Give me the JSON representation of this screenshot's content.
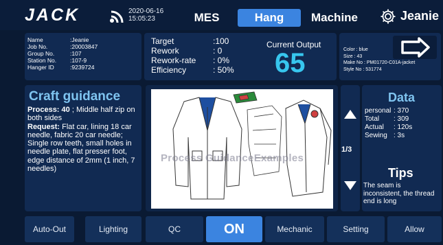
{
  "header": {
    "logo": "JACK",
    "date": "2020-06-16",
    "time": "15:05:23",
    "tabs": [
      "MES",
      "Hang",
      "Machine"
    ],
    "active_tab": "Hang",
    "user": "Jeanie",
    "colors": {
      "active": "#3b84e0",
      "accent": "#37c6ee"
    },
    "icons": [
      "wifi-icon",
      "gear-icon",
      "logout-arrow-icon"
    ]
  },
  "worker_info": {
    "name_label": "Name",
    "name": ":Jeanie",
    "job_label": "Job No.",
    "job": ":20003847",
    "group_label": "Group No.",
    "group": ":107",
    "station_label": "Station No.",
    "station": ":107-9",
    "hanger_label": "Hanger ID",
    "hanger": ":9239724"
  },
  "stats": {
    "target_label": "Target",
    "target": ":100",
    "rework_label": "Rework",
    "rework": ": 0",
    "rework_rate_label": "Rework-rate",
    "rework_rate": ": 0%",
    "efficiency_label": "Efficiency",
    "efficiency": ": 50%",
    "current_output_label": "Current Output",
    "current_output": "65"
  },
  "style": {
    "color": "Color : blue",
    "size": "Size  :  43",
    "make_no": "Make No : PM01720-C01A-jacket",
    "style_no": "Style No : 531774"
  },
  "craft": {
    "title": "Craft guidance",
    "process_label": "Process:",
    "process_no": "40",
    "process_text": "; Middle half zip on both sides",
    "request_label": "Request:",
    "request_text": "Flat car, lining 18 car needle, fabric 20 car needle; Single row teeth, small holes in needle plate, flat presser foot, edge distance of 2mm (1 inch, 7 needles)"
  },
  "guidance_image": {
    "watermark": "Process GuidanceExamples"
  },
  "pager": {
    "indicator": "1/3"
  },
  "data_panel": {
    "title": "Data",
    "personal_label": "personal",
    "personal": ":  370",
    "total_label": "Total",
    "total": ":  309",
    "actual_label": "Actual",
    "actual": ":  120s",
    "sewing_label": "Sewing",
    "sewing": ":  3s"
  },
  "tips": {
    "title": "Tips",
    "text": "The seam is inconsistent, the thread end is long"
  },
  "bottom_bar": {
    "auto_out": "Auto-Out",
    "lighting": "Lighting",
    "qc": "QC",
    "on": "ON",
    "mechanic": "Mechanic",
    "setting": "Setting",
    "allow": "Allow"
  }
}
